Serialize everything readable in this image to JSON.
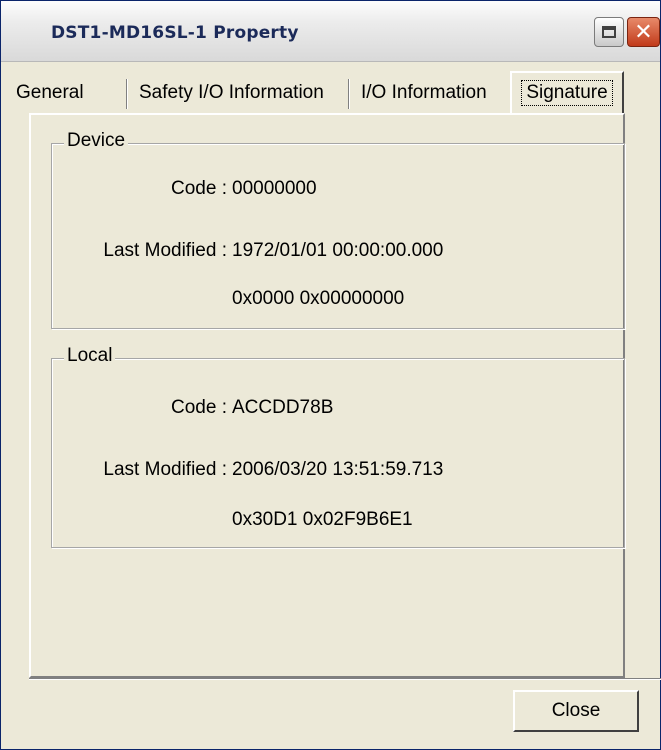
{
  "window": {
    "title": "DST1-MD16SL-1 Property"
  },
  "titlebar": {
    "maximize_icon": "maximize-icon",
    "close_icon": "close-icon",
    "close_glyph": "✕"
  },
  "tabs": [
    {
      "label": "General",
      "active": false
    },
    {
      "label": "Safety I/O Information",
      "active": false
    },
    {
      "label": "I/O Information",
      "active": false
    },
    {
      "label": "Signature",
      "active": true
    }
  ],
  "device": {
    "legend": "Device",
    "code_label": "Code :",
    "code_value": "00000000",
    "modified_label": "Last Modified :",
    "modified_value": "1972/01/01 00:00:00.000",
    "modified_hex": "0x0000 0x00000000"
  },
  "local": {
    "legend": "Local",
    "code_label": "Code :",
    "code_value": "ACCDD78B",
    "modified_label": "Last Modified :",
    "modified_value": "2006/03/20 13:51:59.713",
    "modified_hex": "0x30D1 0x02F9B6E1"
  },
  "footer": {
    "close_label": "Close"
  },
  "colors": {
    "window_bg": "#ece9d8",
    "title_text": "#1b2a59",
    "close_button": "#c13a1a"
  }
}
